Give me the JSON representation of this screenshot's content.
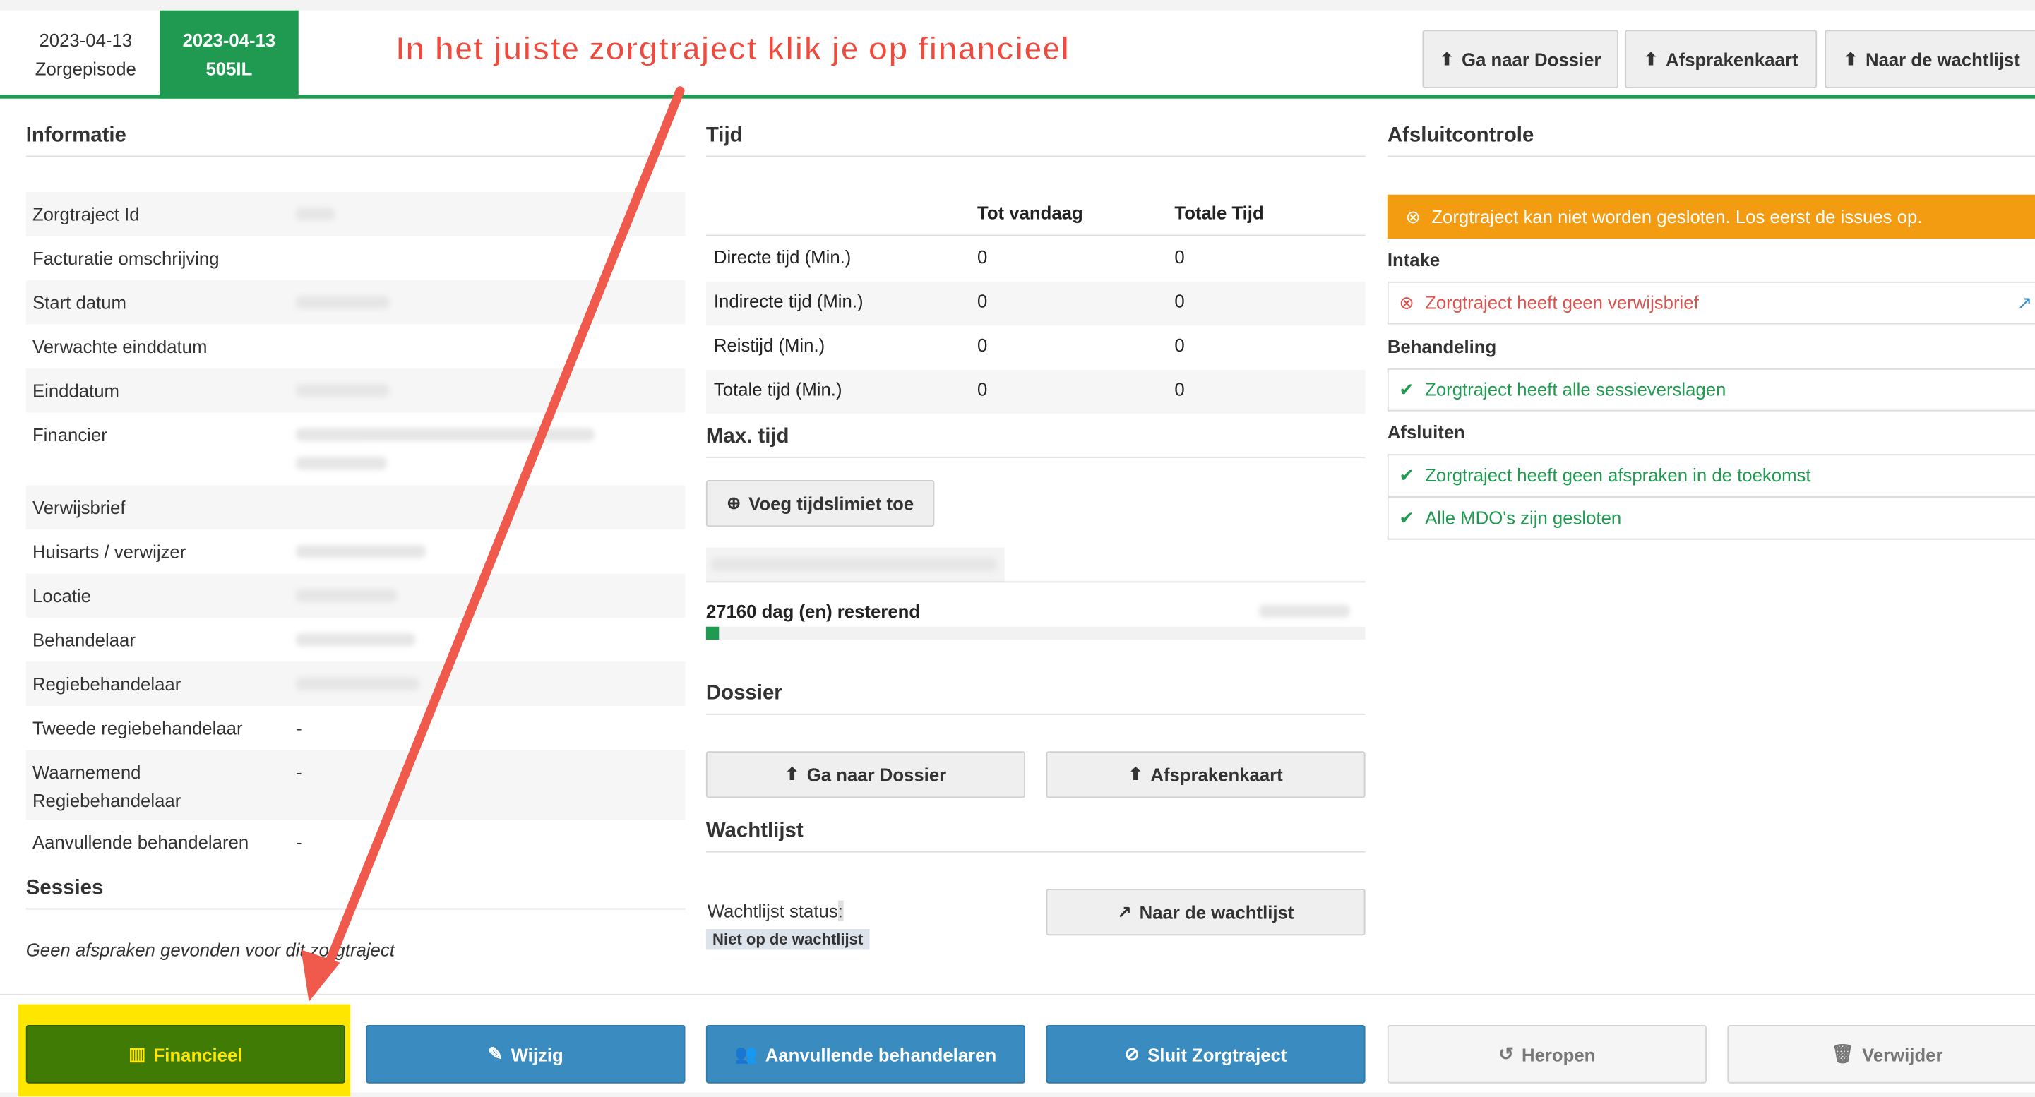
{
  "tabs": [
    {
      "date": "2023-04-13",
      "label": "Zorgepisode"
    },
    {
      "date": "2023-04-13",
      "label": "505IL"
    }
  ],
  "annotation": "In het juiste zorgtraject klik je op financieel",
  "top_buttons": [
    "Ga naar Dossier",
    "Afsprakenkaart",
    "Naar de wachtlijst"
  ],
  "informatie": {
    "title": "Informatie",
    "rows": [
      {
        "label": "Zorgtraject Id",
        "value": ""
      },
      {
        "label": "Facturatie omschrijving",
        "value": ""
      },
      {
        "label": "Start datum",
        "value": ""
      },
      {
        "label": "Verwachte einddatum",
        "value": ""
      },
      {
        "label": "Einddatum",
        "value": ""
      },
      {
        "label": "Financier",
        "value": ""
      },
      {
        "label": "Verwijsbrief",
        "value": ""
      },
      {
        "label": "Huisarts / verwijzer",
        "value": ""
      },
      {
        "label": "Locatie",
        "value": ""
      },
      {
        "label": "Behandelaar",
        "value": ""
      },
      {
        "label": "Regiebehandelaar",
        "value": ""
      },
      {
        "label": "Tweede regiebehandelaar",
        "value": "-"
      },
      {
        "label": "Waarnemend Regiebehandelaar",
        "value": "-"
      },
      {
        "label": "Aanvullende behandelaren",
        "value": "-"
      }
    ]
  },
  "sessies": {
    "title": "Sessies",
    "empty": "Geen afspraken gevonden voor dit zorgtraject"
  },
  "tijd": {
    "title": "Tijd",
    "headers": [
      "Tot vandaag",
      "Totale Tijd"
    ],
    "rows": [
      {
        "label": "Directe tijd (Min.)",
        "tot": "0",
        "totaal": "0"
      },
      {
        "label": "Indirecte tijd (Min.)",
        "tot": "0",
        "totaal": "0"
      },
      {
        "label": "Reistijd (Min.)",
        "tot": "0",
        "totaal": "0"
      },
      {
        "label": "Totale tijd (Min.)",
        "tot": "0",
        "totaal": "0"
      }
    ]
  },
  "maxtijd": {
    "title": "Max. tijd",
    "button": "Voeg tijdslimiet toe",
    "remaining": "27160 dag (en) resterend",
    "progress_percent": 2
  },
  "dossier": {
    "title": "Dossier",
    "btn1": "Ga naar Dossier",
    "btn2": "Afsprakenkaart"
  },
  "wachtlijst": {
    "title": "Wachtlijst",
    "status_label": "Wachtlijst status:",
    "status": "Niet op de wachtlijst",
    "button": "Naar de wachtlijst"
  },
  "afsluit": {
    "title": "Afsluitcontrole",
    "warning": "Zorgtraject kan niet worden gesloten. Los eerst de issues op.",
    "intake": "Intake",
    "intake_item": "Zorgtraject heeft geen verwijsbrief",
    "behandeling": "Behandeling",
    "behandeling_item": "Zorgtraject heeft alle sessieverslagen",
    "afsluiten": "Afsluiten",
    "afsluiten_items": [
      "Zorgtraject heeft geen afspraken in de toekomst",
      "Alle MDO's zijn gesloten"
    ]
  },
  "bottom_buttons": [
    "Financieel",
    "Wijzig",
    "Aanvullende behandelaren",
    "Sluit Zorgtraject",
    "Heropen",
    "Verwijder"
  ],
  "colors": {
    "green": "#1f9a50",
    "blue": "#3a8bbf",
    "orange": "#f39c12",
    "highlight": "#ffe600",
    "arrow": "#ef5a4c"
  }
}
